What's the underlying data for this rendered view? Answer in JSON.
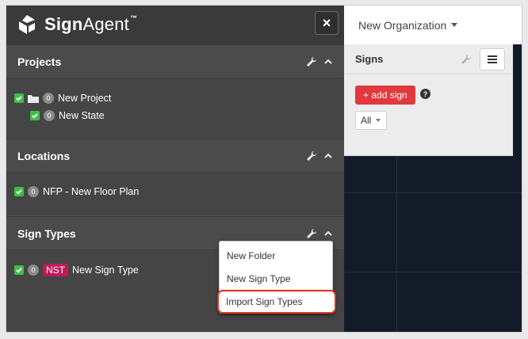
{
  "brand": {
    "name_bold": "Sign",
    "name_regular": "Agent",
    "trademark": "™"
  },
  "header": {
    "close_symbol": "×",
    "organization": "New Organization"
  },
  "projects": {
    "title": "Projects",
    "items": [
      {
        "count": "0",
        "label": "New Project"
      },
      {
        "count": "0",
        "label": "New State"
      }
    ]
  },
  "locations": {
    "title": "Locations",
    "items": [
      {
        "count": "0",
        "label": "NFP - New Floor Plan"
      }
    ]
  },
  "sign_types": {
    "title": "Sign Types",
    "items": [
      {
        "count": "0",
        "abbr": "NST",
        "label": "New Sign Type"
      }
    ]
  },
  "signs_panel": {
    "title": "Signs",
    "add_label": "+ add sign",
    "help_symbol": "?",
    "filter_value": "All"
  },
  "dropdown": {
    "items": [
      "New Folder",
      "New Sign Type",
      "Import Sign Types"
    ],
    "highlighted": "Import Sign Types",
    "highlight_color": "#e3341c"
  },
  "icons": [
    "logo-mark-icon",
    "close-icon",
    "wrench-icon",
    "chevron-up-icon",
    "checkbox-icon",
    "folder-icon",
    "caret-down-icon",
    "hamburger-menu-icon",
    "help-icon"
  ]
}
